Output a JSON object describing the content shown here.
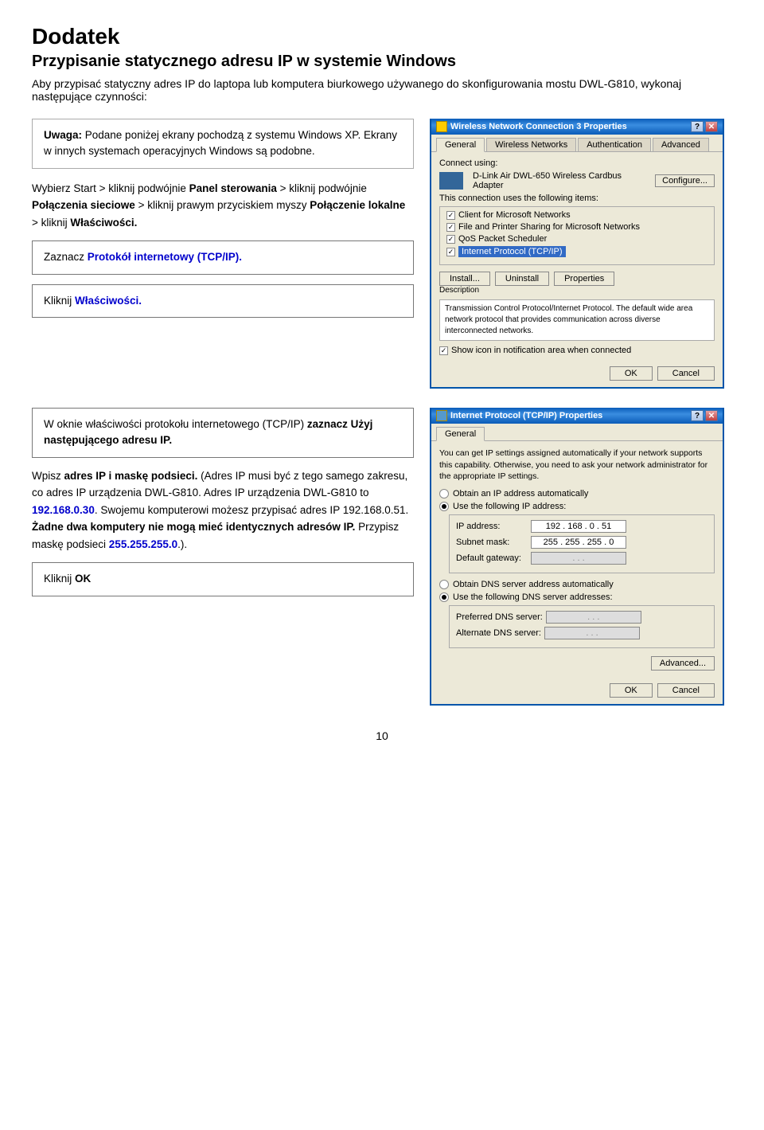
{
  "page": {
    "title": "Dodatek",
    "subtitle": "Przypisanie statycznego adresu IP w systemie Windows",
    "intro": "Aby przypisać statyczny adres IP do laptopa lub komputera biurkowego używanego do skonfigurowania mostu DWL-G810, wykonaj następujące czynności:",
    "page_number": "10"
  },
  "note": {
    "bold_part": "Uwaga:",
    "text": " Podane poniżej ekrany pochodzą z systemu Windows XP. Ekrany w innych systemach operacyjnych Windows są podobne."
  },
  "steps": {
    "step1": "Wybierz Start > kliknij podwójnie Panel sterowania > kliknij podwójnie Połączenia sieciowe > kliknij prawym przyciskiem myszy Połączenie lokalne > kliknij Właściwości.",
    "step2_prefix": "Zaznacz ",
    "step2_highlight": "Protokół internetowy (TCP/IP).",
    "step3_prefix": "Kliknij ",
    "step3_highlight": "Właściwości.",
    "step4_prefix": "W oknie właściwości protokołu internetowego (TCP/IP) ",
    "step4_bold": "zaznacz Użyj następującego adresu IP.",
    "step5_prefix": "Wpisz ",
    "step5_bold": "adres IP i maskę podsieci.",
    "step5_text": " (Adres IP musi być z tego samego zakresu, co adres IP urządzenia DWL-G810. Adres IP urządzenia DWL-G810 to ",
    "step5_highlight": "192.168.0.30",
    "step5_text2": ". Swojemu komputerowi możesz przypisać adres IP 192.168.0.51. ",
    "step5_bold2": "Żadne dwa komputery nie mogą mieć identycznych adresów IP.",
    "step5_text3": " Przypisz maskę podsieci ",
    "step5_highlight2": "255.255.255.0",
    "step5_text4": ".).",
    "step6_prefix": "Kliknij ",
    "step6_bold": "OK"
  },
  "dialog1": {
    "title": "Wireless Network Connection 3 Properties",
    "tabs": [
      "General",
      "Wireless Networks",
      "Authentication",
      "Advanced"
    ],
    "active_tab": "General",
    "connect_using_label": "Connect using:",
    "adapter_name": "D-Link Air DWL-650 Wireless Cardbus Adapter",
    "configure_btn": "Configure...",
    "connection_items_label": "This connection uses the following items:",
    "items": [
      {
        "checked": true,
        "label": "Client for Microsoft Networks"
      },
      {
        "checked": true,
        "label": "File and Printer Sharing for Microsoft Networks"
      },
      {
        "checked": true,
        "label": "QoS Packet Scheduler"
      },
      {
        "checked": true,
        "label": "Internet Protocol (TCP/IP)",
        "selected": true
      }
    ],
    "install_btn": "Install...",
    "uninstall_btn": "Uninstall",
    "properties_btn": "Properties",
    "description_label": "Description",
    "description_text": "Transmission Control Protocol/Internet Protocol. The default wide area network protocol that provides communication across diverse interconnected networks.",
    "show_icon_label": "Show icon in notification area when connected",
    "ok_btn": "OK",
    "cancel_btn": "Cancel"
  },
  "dialog2": {
    "title": "Internet Protocol (TCP/IP) Properties",
    "tabs": [
      "General"
    ],
    "active_tab": "General",
    "intro_text": "You can get IP settings assigned automatically if your network supports this capability. Otherwise, you need to ask your network administrator for the appropriate IP settings.",
    "obtain_auto_label": "Obtain an IP address automatically",
    "use_following_label": "Use the following IP address:",
    "ip_address_label": "IP address:",
    "ip_address_value": "192 . 168 . 0 . 51",
    "subnet_mask_label": "Subnet mask:",
    "subnet_mask_value": "255 . 255 . 255 . 0",
    "default_gateway_label": "Default gateway:",
    "default_gateway_value": ". . .",
    "obtain_dns_label": "Obtain DNS server address automatically",
    "use_dns_label": "Use the following DNS server addresses:",
    "preferred_dns_label": "Preferred DNS server:",
    "preferred_dns_value": ". . .",
    "alternate_dns_label": "Alternate DNS server:",
    "alternate_dns_value": ". . .",
    "advanced_btn": "Advanced...",
    "ok_btn": "OK",
    "cancel_btn": "Cancel"
  }
}
